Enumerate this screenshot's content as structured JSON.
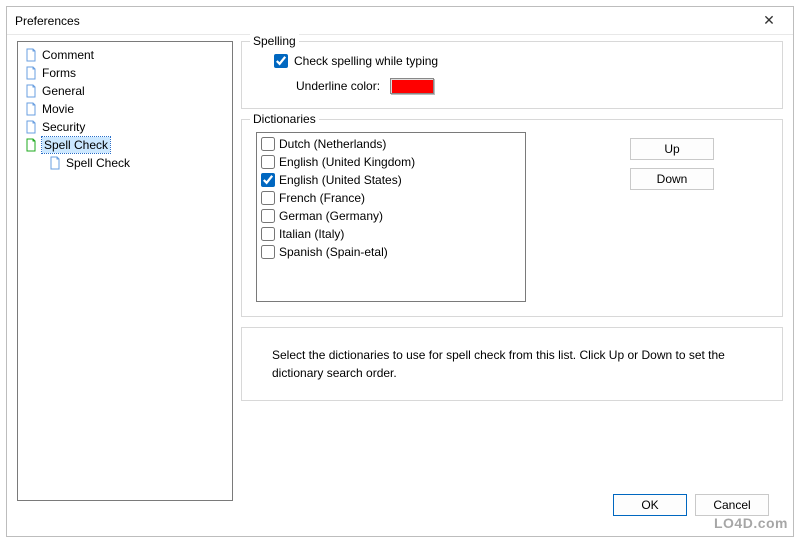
{
  "window": {
    "title": "Preferences",
    "close_glyph": "✕"
  },
  "tree": {
    "items": [
      {
        "label": "Comment",
        "selected": false,
        "indent": false,
        "icon": "default"
      },
      {
        "label": "Forms",
        "selected": false,
        "indent": false,
        "icon": "default"
      },
      {
        "label": "General",
        "selected": false,
        "indent": false,
        "icon": "default"
      },
      {
        "label": "Movie",
        "selected": false,
        "indent": false,
        "icon": "default"
      },
      {
        "label": "Security",
        "selected": false,
        "indent": false,
        "icon": "default"
      },
      {
        "label": "Spell Check",
        "selected": true,
        "indent": false,
        "icon": "highlight"
      },
      {
        "label": "Spell Check",
        "selected": false,
        "indent": true,
        "icon": "default"
      }
    ]
  },
  "spelling": {
    "legend": "Spelling",
    "check_while_typing_label": "Check spelling while typing",
    "check_while_typing_checked": true,
    "underline_color_label": "Underline color:",
    "underline_color": "#ff0000"
  },
  "dictionaries": {
    "legend": "Dictionaries",
    "items": [
      {
        "label": "Dutch (Netherlands)",
        "checked": false
      },
      {
        "label": "English (United Kingdom)",
        "checked": false
      },
      {
        "label": "English (United States)",
        "checked": true
      },
      {
        "label": "French (France)",
        "checked": false
      },
      {
        "label": "German (Germany)",
        "checked": false
      },
      {
        "label": "Italian (Italy)",
        "checked": false
      },
      {
        "label": "Spanish (Spain-etal)",
        "checked": false
      }
    ],
    "up_label": "Up",
    "down_label": "Down"
  },
  "hint": {
    "text": "Select the dictionaries to use for spell check from this list. Click Up or Down to set the dictionary search order."
  },
  "footer": {
    "ok_label": "OK",
    "cancel_label": "Cancel"
  },
  "watermark": "LO4D.com"
}
